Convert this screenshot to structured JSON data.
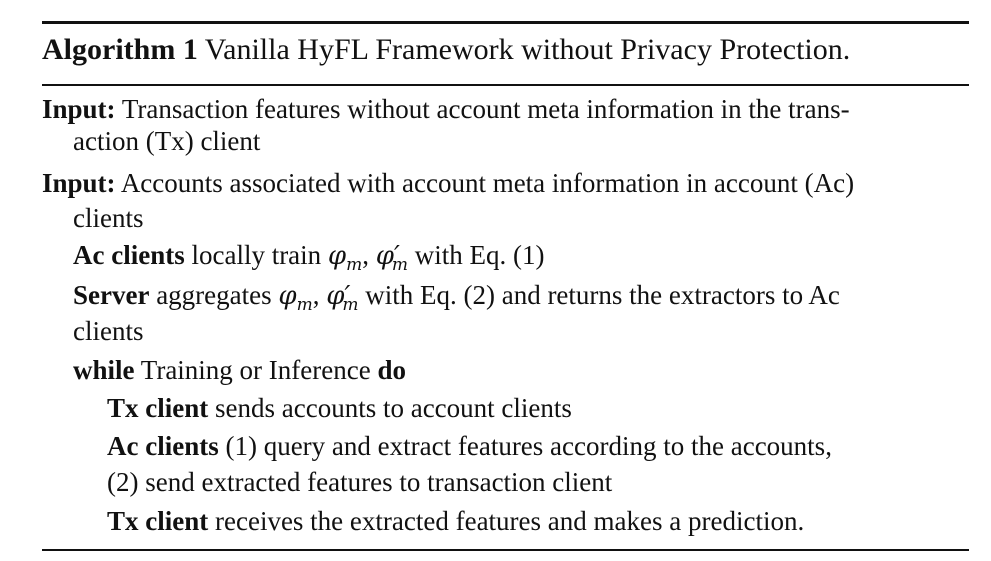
{
  "caption": {
    "label": "Algorithm 1",
    "title": "Vanilla HyFL Framework without Privacy Protection."
  },
  "lines": {
    "input1_kw": "Input:",
    "input1_text_a": "Transaction features without account meta information in the trans-",
    "input1_text_b": "action (Tx) client",
    "input2_kw": "Input:",
    "input2_text_a": "Accounts associated with account meta information in account (Ac)",
    "input2_text_b": "clients",
    "ac_train_kw": "Ac clients",
    "ac_train_text_a": "locally train",
    "ac_train_text_b": "with Eq. (1)",
    "server_kw": "Server",
    "server_text_a": "aggregates",
    "server_text_b": "with Eq. (2) and returns the extractors to Ac",
    "server_text_c": "clients",
    "while_kw": "while",
    "while_text": "Training or Inference",
    "do_kw": "do",
    "tx_send_kw": "Tx client",
    "tx_send_text": "sends accounts to account clients",
    "ac_query_kw": "Ac clients",
    "ac_query_text_a": "(1) query and extract features according to the accounts,",
    "ac_query_text_b": "(2) send extracted features to transaction client",
    "tx_recv_kw": "Tx client",
    "tx_recv_text": "receives the extracted features and makes a prediction."
  },
  "math": {
    "phi": "φ",
    "sub_m": "m",
    "prime": "′",
    "comma": ", "
  }
}
